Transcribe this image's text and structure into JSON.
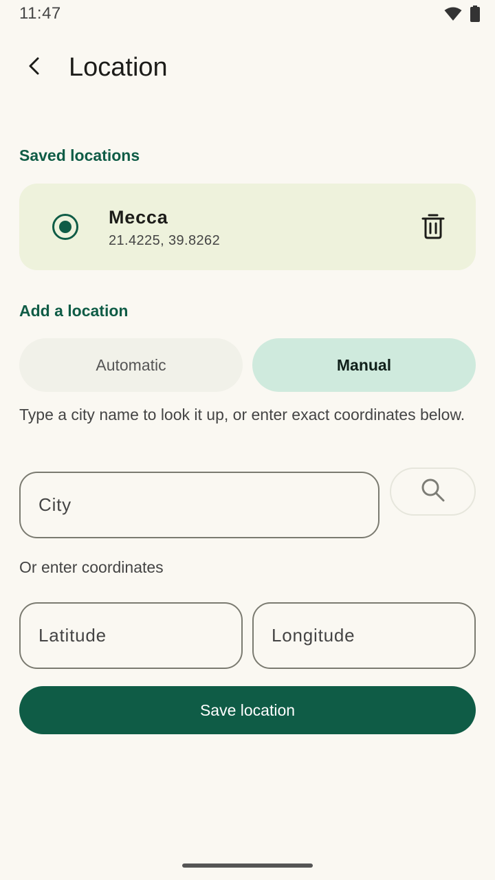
{
  "status_bar": {
    "time": "11:47",
    "icons": [
      "wifi-icon",
      "battery-icon"
    ]
  },
  "header": {
    "title": "Location",
    "back_icon": "arrow-back-icon"
  },
  "saved_section": {
    "label": "Saved locations",
    "items": [
      {
        "name": "Mecca",
        "coords": "21.4225, 39.8262",
        "selected": true,
        "delete_icon": "trash-icon"
      }
    ]
  },
  "add_section": {
    "label": "Add a location",
    "modes": [
      {
        "label": "Automatic",
        "selected": false
      },
      {
        "label": "Manual",
        "selected": true
      }
    ],
    "helper_text": "Type a city name to look it up, or enter exact coordinates below.",
    "city_placeholder": "City",
    "search_icon": "search-icon",
    "coords_label": "Or enter coordinates",
    "latitude_placeholder": "Latitude",
    "longitude_placeholder": "Longitude",
    "save_label": "Save location"
  },
  "colors": {
    "accent": "#0f5c46",
    "card_bg": "#eef2dc",
    "selected_seg": "#cfeadd",
    "background": "#faf8f2"
  }
}
